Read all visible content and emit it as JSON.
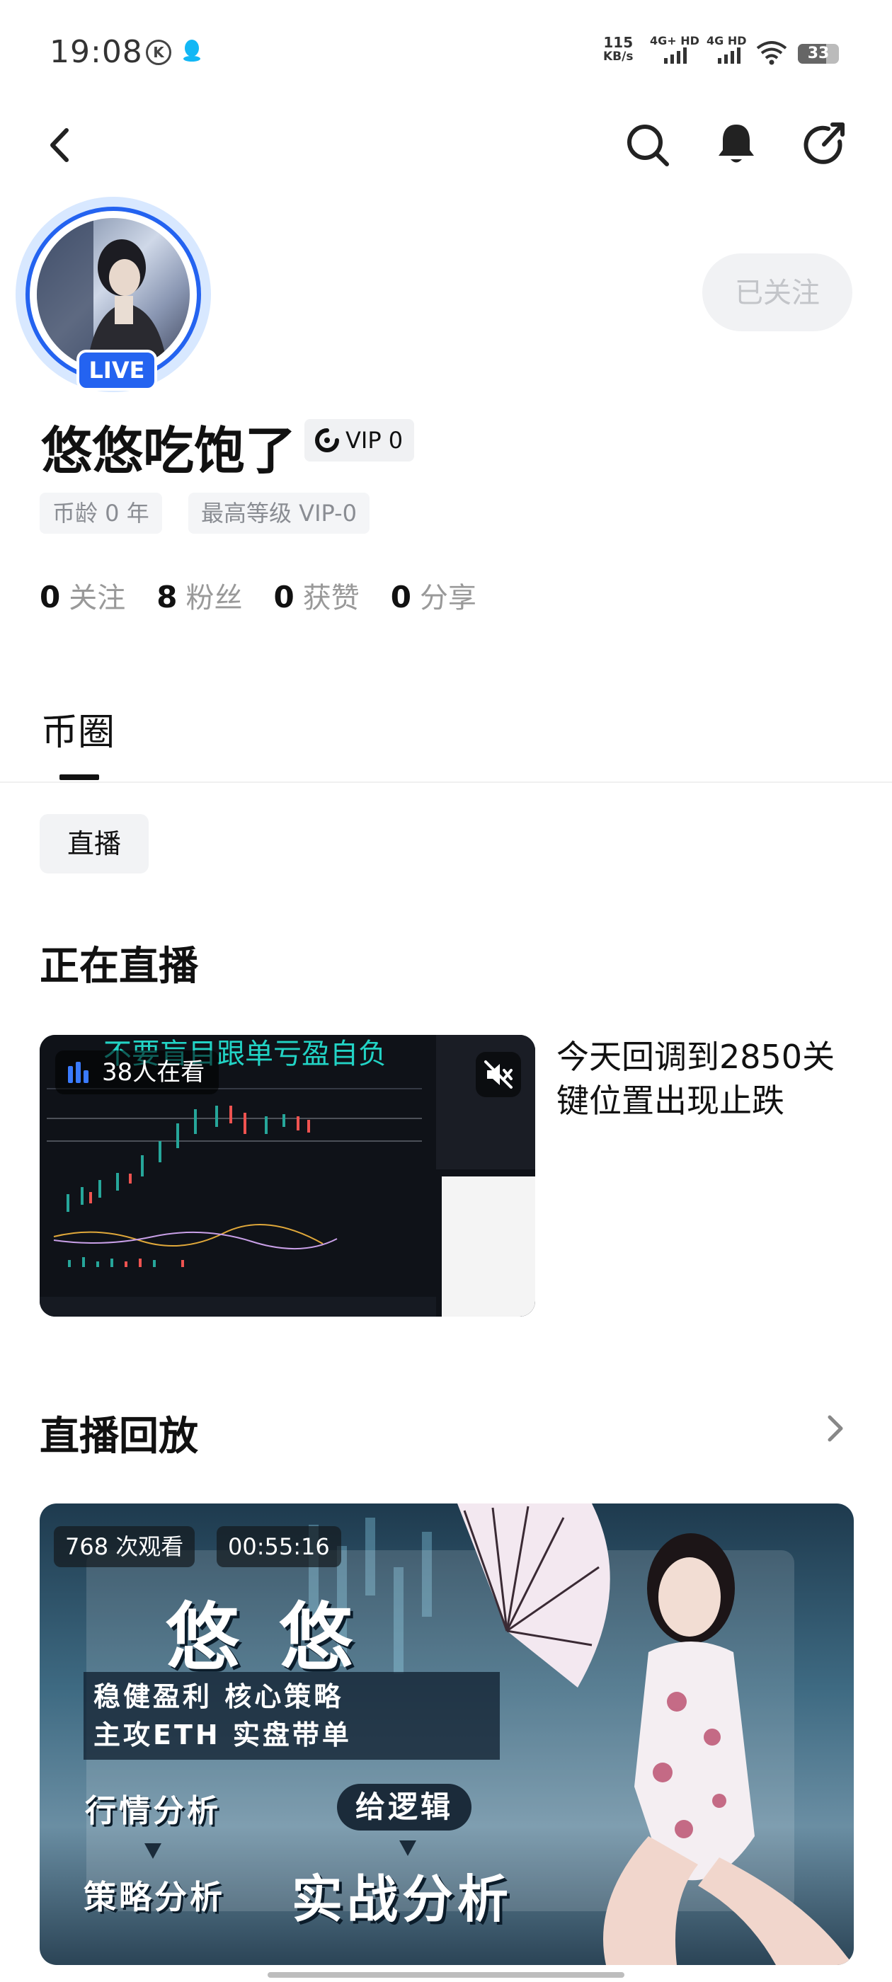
{
  "status_bar": {
    "time": "19:08",
    "k_label": "K",
    "speed_value": "115",
    "speed_unit": "KB/s",
    "net1": "4G+ HD",
    "net2": "4G HD",
    "battery": "33"
  },
  "nav": {
    "back_icon": "chevron-left-icon",
    "search_icon": "search-icon",
    "bell_icon": "bell-icon",
    "share_icon": "share-icon"
  },
  "profile": {
    "live_badge": "LIVE",
    "follow_label": "已关注",
    "name": "悠悠吃饱了",
    "vip_label": "VIP 0",
    "tags": [
      "币龄 0 年",
      "最高等级 VIP-0"
    ],
    "stats": [
      {
        "value": "0",
        "label": "关注"
      },
      {
        "value": "8",
        "label": "粉丝"
      },
      {
        "value": "0",
        "label": "获赞"
      },
      {
        "value": "0",
        "label": "分享"
      }
    ]
  },
  "tabs": {
    "active": "币圈"
  },
  "filter_chip": "直播",
  "live_section": {
    "title": "正在直播",
    "thumb_overlay_text": "不要盲目跟单亏盈自负",
    "viewers": "38人在看",
    "stream_title": "今天回调到2850关键位置出现止跌"
  },
  "replay_section": {
    "title": "直播回放",
    "views": "768 次观看",
    "duration": "00:55:16",
    "poster": {
      "headline": "悠 悠",
      "line1": "稳健盈利  核心策略",
      "line2": "主攻ETH  实盘带单",
      "tag1": "行情分析",
      "tag2": "给逻辑",
      "tag3": "策略分析",
      "tag4": "实战分析"
    }
  },
  "colors": {
    "accent_blue": "#2463f0",
    "text_primary": "#111111",
    "text_secondary": "#999999"
  }
}
